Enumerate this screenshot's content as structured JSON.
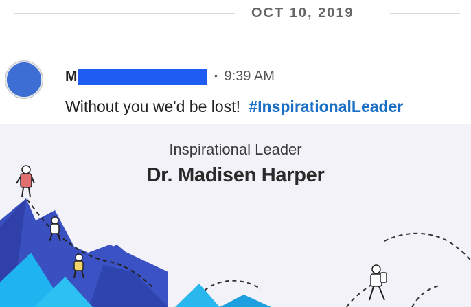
{
  "date_separator": {
    "label": "OCT 10, 2019"
  },
  "message": {
    "sender_initial": "M",
    "separator": "•",
    "time": "9:39 AM",
    "text": "Without you we'd be lost!",
    "hashtag": "#InspirationalLeader"
  },
  "card": {
    "subtitle": "Inspirational Leader",
    "title": "Dr. Madisen Harper"
  },
  "colors": {
    "avatar": "#3c6ed3",
    "redaction": "#1f5cf2",
    "hashtag": "#1a6fc4",
    "card_bg": "#f3f2f8",
    "mountain_dark": "#3a4fc0",
    "mountain_light": "#2ab4ee"
  }
}
